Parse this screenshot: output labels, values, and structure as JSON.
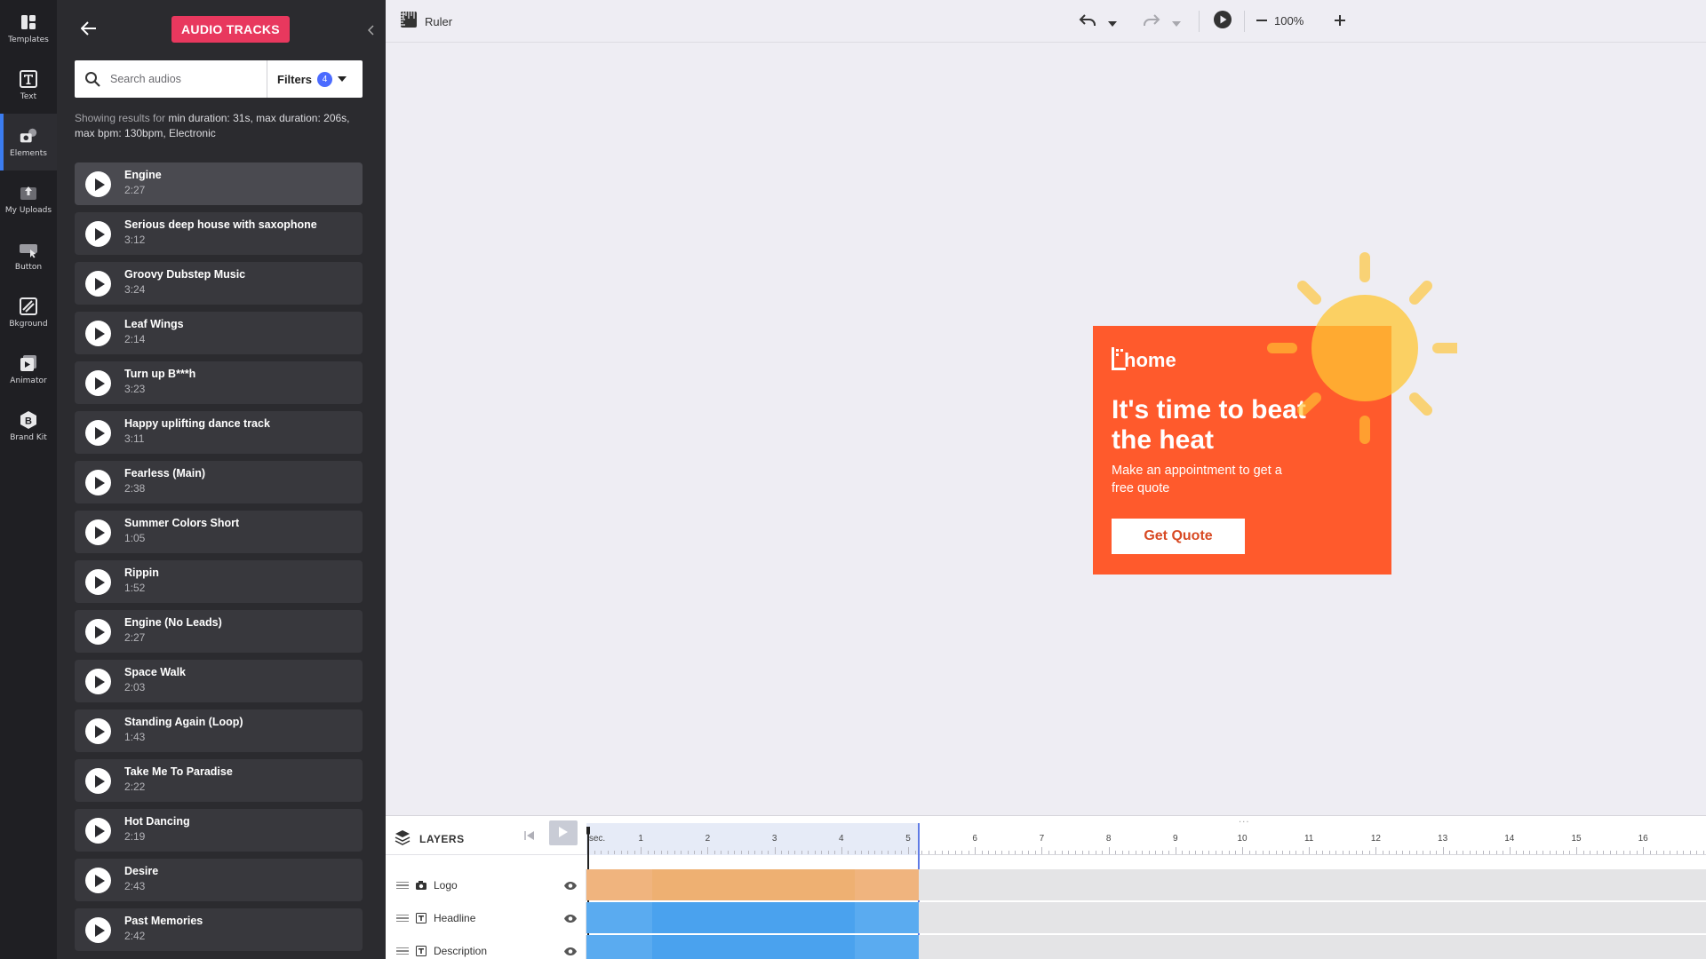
{
  "rail": {
    "items": [
      {
        "label": "Templates",
        "icon": "templates-icon"
      },
      {
        "label": "Text",
        "icon": "text-icon"
      },
      {
        "label": "Elements",
        "icon": "elements-icon",
        "active": true
      },
      {
        "label": "My Uploads",
        "icon": "uploads-icon"
      },
      {
        "label": "Button",
        "icon": "button-icon"
      },
      {
        "label": "Bkground",
        "icon": "background-icon"
      },
      {
        "label": "Animator",
        "icon": "animator-icon"
      },
      {
        "label": "Brand Kit",
        "icon": "brand-kit-icon"
      }
    ]
  },
  "panel": {
    "title": "AUDIO TRACKS",
    "search_placeholder": "Search audios",
    "filters_label": "Filters",
    "filters_count": "4",
    "results_prefix": "Showing results for",
    "results_query": "min duration: 31s, max duration: 206s, max bpm: 130bpm, Electronic",
    "tracks": [
      {
        "title": "Engine",
        "duration": "2:27"
      },
      {
        "title": "Serious deep house with saxophone",
        "duration": "3:12"
      },
      {
        "title": "Groovy Dubstep Music",
        "duration": "3:24"
      },
      {
        "title": "Leaf Wings",
        "duration": "2:14"
      },
      {
        "title": "Turn up B***h",
        "duration": "3:23"
      },
      {
        "title": "Happy uplifting dance track",
        "duration": "3:11"
      },
      {
        "title": "Fearless (Main)",
        "duration": "2:38"
      },
      {
        "title": "Summer Colors Short",
        "duration": "1:05"
      },
      {
        "title": "Rippin",
        "duration": "1:52"
      },
      {
        "title": "Engine (No Leads)",
        "duration": "2:27"
      },
      {
        "title": "Space Walk",
        "duration": "2:03"
      },
      {
        "title": "Standing Again (Loop)",
        "duration": "1:43"
      },
      {
        "title": "Take Me To Paradise",
        "duration": "2:22"
      },
      {
        "title": "Hot Dancing",
        "duration": "2:19"
      },
      {
        "title": "Desire",
        "duration": "2:43"
      },
      {
        "title": "Past Memories",
        "duration": "2:42"
      }
    ]
  },
  "toolbar": {
    "ruler_label": "Ruler",
    "zoom": "100%"
  },
  "ad": {
    "logo_text": "home",
    "headline": "It's time to beat the heat",
    "description": "Make an appointment to get a free quote",
    "cta": "Get Quote",
    "colors": {
      "background": "#ff5a2c",
      "sun": "#ffc533",
      "cta_text": "#d84a24"
    }
  },
  "timeline": {
    "layers_label": "LAYERS",
    "ruler_first_label": "sec.",
    "tick_labels": [
      "1",
      "2",
      "3",
      "4",
      "5",
      "6",
      "7",
      "8",
      "9",
      "10",
      "11",
      "12",
      "13",
      "14",
      "15",
      "16"
    ],
    "layers": [
      {
        "name": "Logo",
        "type": "image",
        "color": "#f0b47e"
      },
      {
        "name": "Headline",
        "type": "text",
        "color": "#5aabf0"
      },
      {
        "name": "Description",
        "type": "text",
        "color": "#5aabf0"
      }
    ]
  },
  "colors": {
    "accent_pink": "#e8385e",
    "filter_badge": "#4b6bff",
    "rail_bg": "#1f1f23",
    "panel_bg": "#2b2b2f",
    "canvas_bg": "#eeedf3"
  }
}
